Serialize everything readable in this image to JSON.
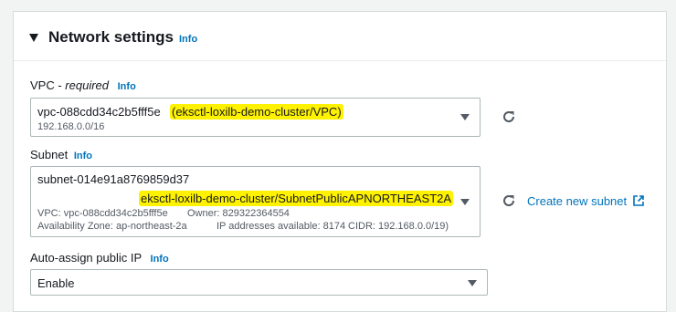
{
  "section": {
    "title": "Network settings",
    "info_label": "Info"
  },
  "vpc": {
    "label": "VPC - ",
    "required": "required",
    "info_label": "Info",
    "id": "vpc-088cdd34c2b5fff5e",
    "name": "(eksctl-loxilb-demo-cluster/VPC)",
    "cidr": "192.168.0.0/16",
    "refresh_icon": "refresh-icon"
  },
  "subnet": {
    "label": "Subnet",
    "info_label": "Info",
    "id": "subnet-014e91a8769859d37",
    "name": "eksctl-loxilb-demo-cluster/SubnetPublicAPNORTHEAST2A",
    "vpc_line": "VPC: vpc-088cdd34c2b5fff5e",
    "owner_line": "Owner: 829322364554",
    "az_line": "Availability Zone: ap-northeast-2a",
    "ip_line": "IP addresses available: 8174",
    "cidr_line": "CIDR: 192.168.0.0/19)",
    "create_link": "Create new subnet",
    "refresh_icon": "refresh-icon",
    "external_icon": "external-link-icon"
  },
  "public_ip": {
    "label": "Auto-assign public IP",
    "info_label": "Info",
    "value": "Enable"
  },
  "colors": {
    "link": "#0073bb",
    "highlight": "#fff200"
  }
}
